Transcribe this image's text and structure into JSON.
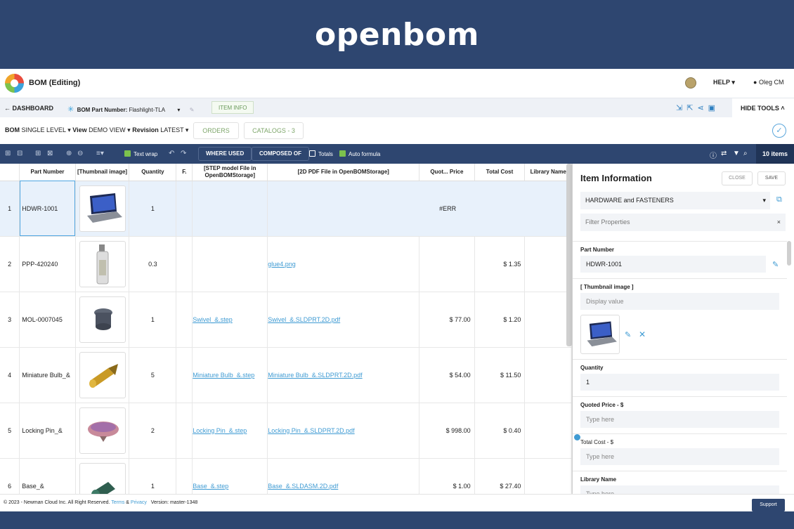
{
  "banner": {
    "logo_text": "openbom"
  },
  "header": {
    "app_title": "BOM (Editing)",
    "help_label": "HELP",
    "user_name": "Oleg CM"
  },
  "subheader": {
    "dashboard_label": "DASHBOARD",
    "bom_part_number_label": "BOM Part Number:",
    "bom_part_number_value": "Flashlight-TLA",
    "item_info_label": "ITEM INFO",
    "hide_tools_label": "HIDE TOOLS"
  },
  "view_bar": {
    "bom_label": "BOM",
    "bom_value": "SINGLE LEVEL",
    "view_label": "View",
    "view_value": "DEMO VIEW",
    "revision_label": "Revision",
    "revision_value": "LATEST",
    "orders_label": "ORDERS",
    "catalogs_label": "CATALOGS - 3"
  },
  "toolbar": {
    "text_wrap_label": "Text wrap",
    "text_wrap_checked": true,
    "where_used_label": "WHERE USED",
    "composed_of_label": "COMPOSED OF",
    "totals_label": "Totals",
    "totals_checked": false,
    "auto_formula_label": "Auto formula",
    "auto_formula_checked": true,
    "items_count": "10 items"
  },
  "grid": {
    "columns": [
      "Part Number",
      "[Thumbnail image]",
      "Quantity",
      "F.",
      "[STEP model File in OpenBOMStorage]",
      "[2D PDF File in OpenBOMStorage]",
      "Quot... Price",
      "Total Cost",
      "Library Name"
    ],
    "error_value": "#ERR",
    "rows": [
      {
        "n": "1",
        "part": "HDWR-1001",
        "thumb": "laptop",
        "qty": "1",
        "step": "",
        "pdf": "",
        "price": "",
        "total": ""
      },
      {
        "n": "2",
        "part": "PPP-420240",
        "thumb": "glue",
        "qty": "0.3",
        "step": "",
        "pdf": "glue4.png",
        "price": "",
        "total": "$ 1.35"
      },
      {
        "n": "3",
        "part": "MOL-0007045",
        "thumb": "swivel",
        "qty": "1",
        "step": "Swivel_&.step",
        "pdf": "Swivel_&.SLDPRT.2D.pdf",
        "price": "$ 77.00",
        "total": "$ 1.20"
      },
      {
        "n": "4",
        "part": "Miniature Bulb_&",
        "thumb": "bulb",
        "qty": "5",
        "step": "Miniature Bulb_&.step",
        "pdf": "Miniature Bulb_&.SLDPRT.2D.pdf",
        "price": "$ 54.00",
        "total": "$ 11.50"
      },
      {
        "n": "5",
        "part": "Locking Pin_&",
        "thumb": "pin",
        "qty": "2",
        "step": "Locking Pin_&.step",
        "pdf": "Locking Pin_&.SLDPRT.2D.pdf",
        "price": "$ 998.00",
        "total": "$ 0.40"
      },
      {
        "n": "6",
        "part": "Base_&",
        "thumb": "base",
        "qty": "1",
        "step": "Base_&.step",
        "pdf": "Base_&.SLDASM.2D.pdf",
        "price": "$ 1.00",
        "total": "$ 27.40"
      }
    ]
  },
  "panel": {
    "title": "Item Information",
    "close_label": "CLOSE",
    "save_label": "SAVE",
    "catalog_value": "HARDWARE and FASTENERS",
    "filter_placeholder": "Filter Properties",
    "fields": {
      "part_number_label": "Part Number",
      "part_number_value": "HDWR-1001",
      "thumbnail_label": "[ Thumbnail image ]",
      "thumbnail_placeholder": "Display value",
      "quantity_label": "Quantity",
      "quantity_value": "1",
      "quoted_price_label": "Quoted Price - $",
      "quoted_price_placeholder": "Type here",
      "total_cost_label": "Total Cost - $",
      "total_cost_placeholder": "Type here",
      "library_name_label": "Library Name",
      "library_name_placeholder": "Type here"
    }
  },
  "footer": {
    "copyright": "© 2023 - Newman Cloud Inc. All Right Reserved.",
    "terms_label": "Terms",
    "amp": "&",
    "privacy_label": "Privacy",
    "version": "Version: master-1348",
    "support_label": "Support"
  }
}
